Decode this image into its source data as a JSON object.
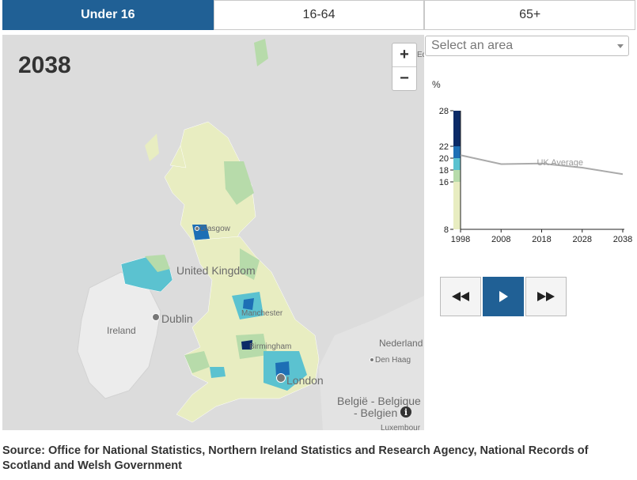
{
  "tabs": [
    {
      "label": "Under 16",
      "active": true
    },
    {
      "label": "16-64",
      "active": false
    },
    {
      "label": "65+",
      "active": false
    }
  ],
  "map": {
    "year": "2038",
    "zoom_in_label": "+",
    "zoom_out_label": "−",
    "labels": {
      "glasgow": "Glasgow",
      "united_kingdom": "United Kingdom",
      "dublin": "Dublin",
      "ireland": "Ireland",
      "manchester": "Manchester",
      "birmingham": "Birmingham",
      "london": "London",
      "nederland": "Nederland",
      "den_haag": "Den Haag",
      "belgie_1": "België - Belgique",
      "belgie_2": "- Belgien",
      "edinburgh_partial": "Ed",
      "luxembourg_partial": "Luxembour"
    },
    "info_icon": "info-icon",
    "colors": {
      "land": "#e8edc1",
      "green": "#b7dbaa",
      "teal": "#5bc2d0",
      "blue": "#1d6fb5",
      "navy": "#0b2a67",
      "background": "#dcdcdc"
    }
  },
  "select": {
    "placeholder": "Select an area"
  },
  "chart_data": {
    "type": "line",
    "ylabel": "%",
    "x_ticks": [
      "1998",
      "2008",
      "2018",
      "2028",
      "2038"
    ],
    "y_ticks": [
      "8",
      "16",
      "18",
      "20",
      "22",
      "28"
    ],
    "ylim": [
      8,
      28
    ],
    "xlim": [
      1998,
      2038
    ],
    "series": [
      {
        "name": "UK Average",
        "color": "#aaaaaa",
        "x": [
          1998,
          2008,
          2018,
          2028,
          2038
        ],
        "y": [
          20.5,
          19.0,
          19.1,
          18.4,
          17.3
        ]
      }
    ],
    "legend_bands": [
      {
        "from": 8,
        "to": 16,
        "color": "#e8edc1"
      },
      {
        "from": 16,
        "to": 18,
        "color": "#b7dbaa"
      },
      {
        "from": 18,
        "to": 20,
        "color": "#5bc2d0"
      },
      {
        "from": 20,
        "to": 22,
        "color": "#1d6fb5"
      },
      {
        "from": 22,
        "to": 28,
        "color": "#0b2a67"
      }
    ]
  },
  "player": {
    "rewind_icon": "rewind-icon",
    "play_icon": "play-icon",
    "forward_icon": "fast-forward-icon"
  },
  "source": "Source: Office for National Statistics, Northern Ireland Statistics and Research Agency, National Records of Scotland and Welsh Government"
}
